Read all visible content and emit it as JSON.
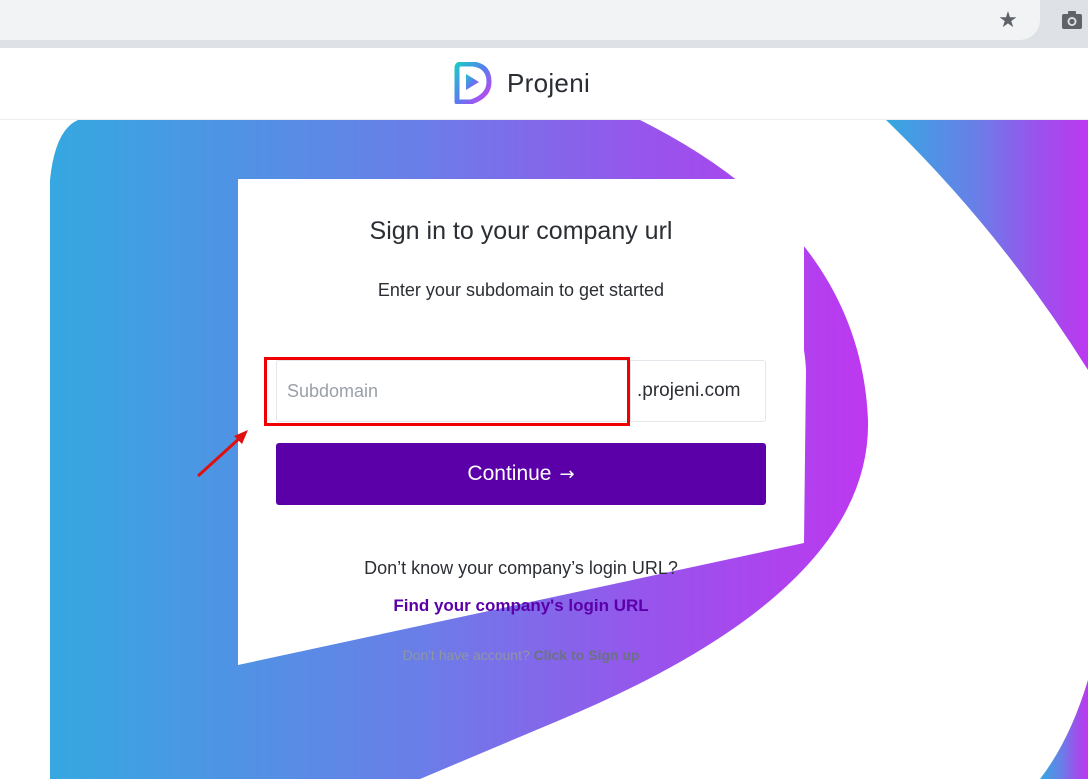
{
  "browser": {
    "star_icon": "star-icon",
    "camera_icon": "camera-icon"
  },
  "header": {
    "brand_name": "Projeni",
    "logo_icon": "projeni-logo-icon"
  },
  "card": {
    "title": "Sign in to your company url",
    "subtitle": "Enter your subdomain to get started",
    "subdomain_placeholder": "Subdomain",
    "subdomain_value": "",
    "domain_suffix": ".projeni.com",
    "continue_label": "Continue",
    "continue_arrow": "→"
  },
  "help": {
    "question": "Don’t know your company’s login URL?",
    "find_link": "Find your company's login URL",
    "no_account": "Don't have account?",
    "signup_link": "Click to Sign up"
  },
  "colors": {
    "brand_purple": "#5b00a8",
    "highlight_red": "#f00000",
    "gradient_start": "#35a8e0",
    "gradient_end": "#b93ff0"
  }
}
